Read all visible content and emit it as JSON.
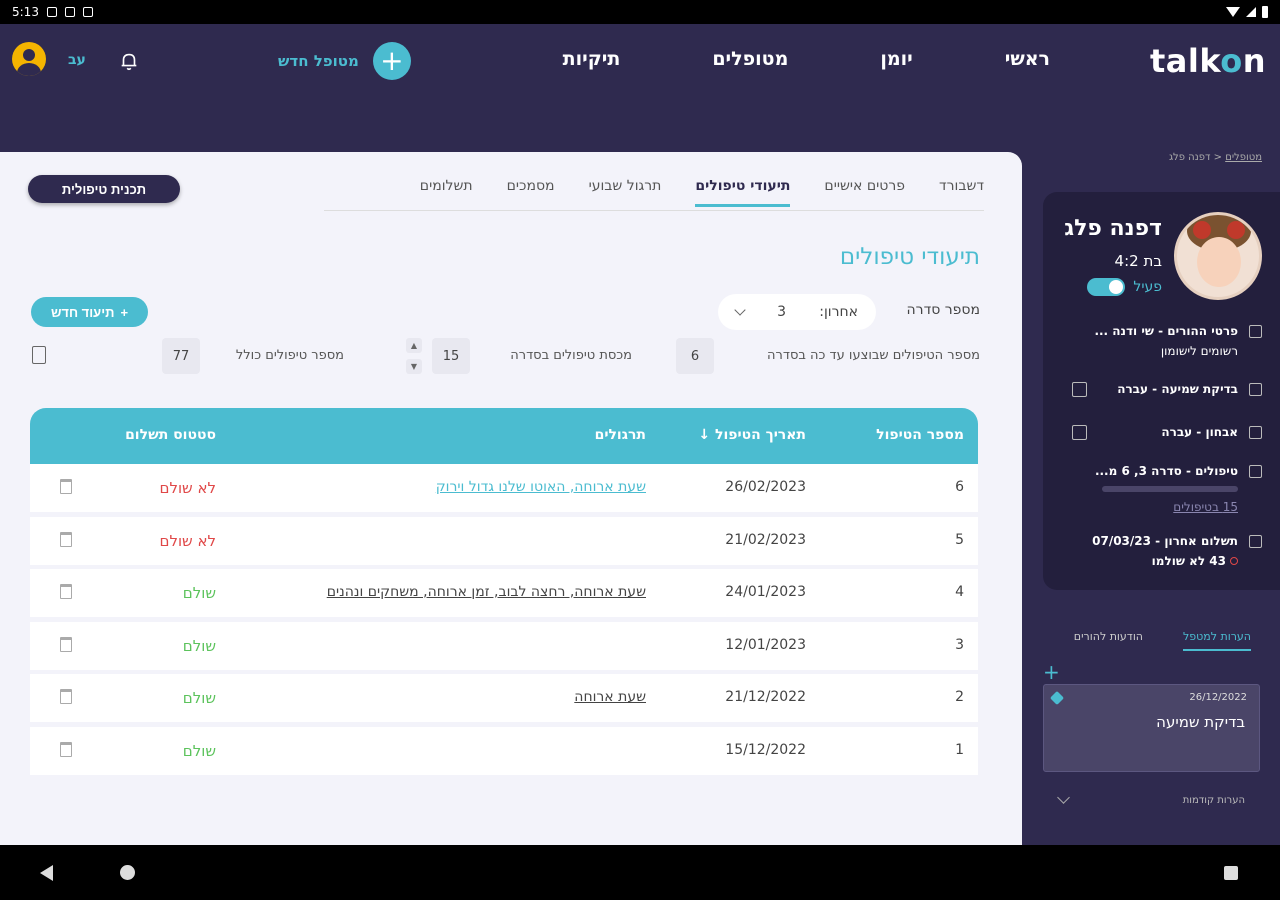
{
  "status_bar": {
    "time": "5:13"
  },
  "header": {
    "logo_main": "talk",
    "logo_o": "o",
    "logo_end": "n",
    "nav": [
      "ראשי",
      "יומן",
      "מטופלים",
      "תיקיות"
    ],
    "new_patient_label": "מטופל חדש",
    "user_name": "עב"
  },
  "tabs": [
    "דשבורד",
    "פרטים אישיים",
    "תיעודי טיפולים",
    "תרגול שבועי",
    "מסמכים",
    "תשלומים"
  ],
  "plan_button": "תכנית טיפולית",
  "section_title": "תיעודי טיפולים",
  "series": {
    "label": "מספר סדרה",
    "select_prefix": "אחרון:",
    "select_value": "3"
  },
  "new_doc_button": "תיעוד חדש",
  "stats": {
    "done_label": "מספר הטיפולים שבוצעו עד כה בסדרה",
    "done_value": "6",
    "quota_label": "מכסת טיפולים בסדרה",
    "quota_value": "15",
    "total_label": "מספר טיפולים כולל",
    "total_value": "77"
  },
  "table": {
    "headers": [
      "מספר הטיפול",
      "תאריך הטיפול ↓",
      "תרגולים",
      "סטטוס תשלום"
    ],
    "rows": [
      {
        "num": "6",
        "date": "26/02/2023",
        "exercises": "שעת ארוחה, האוטו שלנו גדול וירוק",
        "status": "לא שולם",
        "paid": false
      },
      {
        "num": "5",
        "date": "21/02/2023",
        "exercises": "",
        "status": "לא שולם",
        "paid": false
      },
      {
        "num": "4",
        "date": "24/01/2023",
        "exercises": "שעת ארוחה, רחצה לבוב, זמן ארוחה, משחקים ונהנים",
        "status": "שולם",
        "paid": true
      },
      {
        "num": "3",
        "date": "12/01/2023",
        "exercises": "",
        "status": "שולם",
        "paid": true
      },
      {
        "num": "2",
        "date": "21/12/2022",
        "exercises": "שעת ארוחה",
        "status": "שולם",
        "paid": true
      },
      {
        "num": "1",
        "date": "15/12/2022",
        "exercises": "",
        "status": "שולם",
        "paid": true
      }
    ]
  },
  "breadcrumb": {
    "link": "מטופלים",
    "sep": "<",
    "current": "דפנה פלג"
  },
  "profile": {
    "name": "דפנה פלג",
    "age": "בת 4:2",
    "active_label": "פעיל",
    "parents_line1": "פרטי ההורים - שי ודנה ...",
    "parents_line2": "רשומים לישומון",
    "hearing": "בדיקת שמיעה - עברה",
    "diagnosis": "אבחון - עברה",
    "treatments": "טיפולים - סדרה 3, 6 מ...",
    "treatments_link": "15 בטיפולים",
    "payment_line1": "תשלום אחרון - 07/03/23",
    "payment_line2": "43 לא שולמו"
  },
  "notes": {
    "tab_active": "הערות למטפל",
    "tab_other": "הודעות להורים",
    "note_date": "26/12/2022",
    "note_text": "בדיקת שמיעה",
    "previous": "הערות קודמות"
  }
}
